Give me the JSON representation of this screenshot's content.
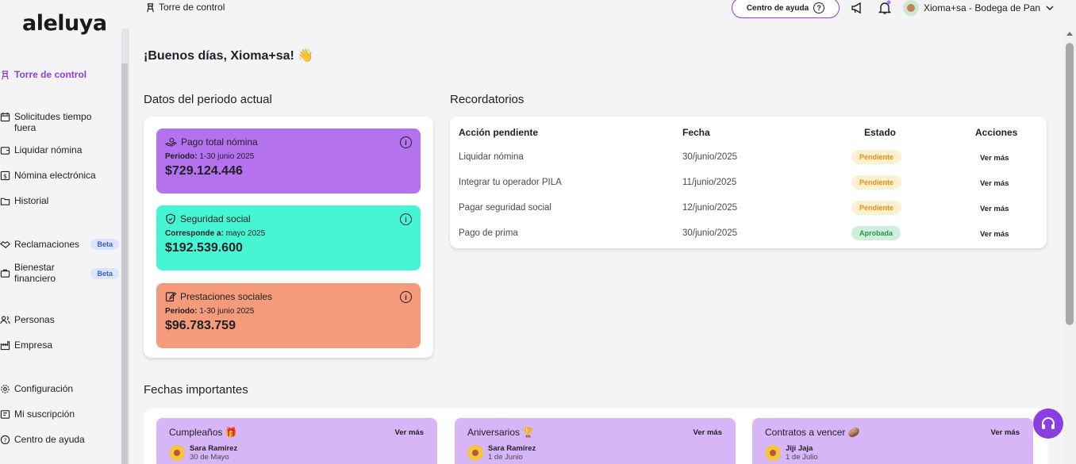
{
  "brand": {
    "logo": "aleluya"
  },
  "sidebar": {
    "items": [
      {
        "label": "Torre de control"
      },
      {
        "label": "Solicitudes tiempo fuera"
      },
      {
        "label": "Liquidar nómina"
      },
      {
        "label": "Nómina electrónica"
      },
      {
        "label": "Historial"
      },
      {
        "label": "Reclamaciones",
        "badge": "Beta"
      },
      {
        "label": "Bienestar financiero",
        "badge": "Beta"
      },
      {
        "label": "Personas"
      },
      {
        "label": "Empresa"
      },
      {
        "label": "Configuración"
      },
      {
        "label": "Mi suscripción"
      },
      {
        "label": "Centro de ayuda"
      }
    ]
  },
  "header": {
    "breadcrumb": "Torre de control",
    "help_button": "Centro de ayuda",
    "user": "Xioma+sa - Bodega de Pan"
  },
  "greeting": "¡Buenos días, Xioma+sa! 👋",
  "period": {
    "title": "Datos del periodo actual",
    "cards": [
      {
        "title": "Pago total nómina",
        "period_label": "Periodo:",
        "period_value": "1-30 junio 2025",
        "amount": "$729.124.446",
        "color": "#b572ee"
      },
      {
        "title": "Seguridad social",
        "period_label": "Corresponde a:",
        "period_value": "mayo 2025",
        "amount": "$192.539.600",
        "color": "#46f5d3"
      },
      {
        "title": "Prestaciones sociales",
        "period_label": "Periodo:",
        "period_value": "1-30 junio 2025",
        "amount": "$96.783.759",
        "color": "#f59b7b"
      }
    ]
  },
  "reminders": {
    "title": "Recordatorios",
    "columns": [
      "Acción pendiente",
      "Fecha",
      "Estado",
      "Acciones"
    ],
    "rows": [
      {
        "action": "Liquidar nómina",
        "date": "30/junio/2025",
        "status": "Pendiente",
        "more": "Ver más"
      },
      {
        "action": "Integrar tu operador PILA",
        "date": "11/junio/2025",
        "status": "Pendiente",
        "more": "Ver más"
      },
      {
        "action": "Pagar seguridad social",
        "date": "12/junio/2025",
        "status": "Pendiente",
        "more": "Ver más"
      },
      {
        "action": "Pago de prima",
        "date": "30/junio/2025",
        "status": "Aprobada",
        "more": "Ver más"
      }
    ]
  },
  "dates": {
    "title": "Fechas importantes",
    "cards": [
      {
        "title": "Cumpleaños 🎁",
        "more": "Ver más",
        "person": "Sara Ramírez",
        "date": "30 de Mayo"
      },
      {
        "title": "Aniversarios 🏆",
        "more": "Ver más",
        "person": "Sara Ramírez",
        "date": "1 de Junio"
      },
      {
        "title": "Contratos a vencer 🥔",
        "more": "Ver más",
        "person": "Jiji Jaja",
        "date": "1 de Julio"
      }
    ]
  }
}
